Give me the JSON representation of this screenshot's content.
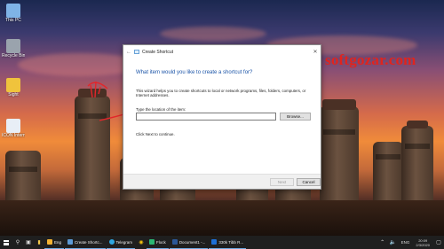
{
  "watermark": "softgozar.com",
  "desktop_icons": [
    {
      "label": "This PC",
      "color": "#7fb3e6"
    },
    {
      "label": "Recycle Bin",
      "color": "#9aa3ad"
    },
    {
      "label": "Sight",
      "color": "#f0c33c"
    },
    {
      "label": "ICON Internet",
      "color": "#e8eef6"
    }
  ],
  "dialog": {
    "title": "Create Shortcut",
    "heading": "What item would you like to create a shortcut for?",
    "description": "This wizard helps you to create shortcuts to local or network programs, files, folders, computers, or Internet addresses.",
    "location_label": "Type the location of the item:",
    "location_value": "",
    "browse_label": "Browse...",
    "hint": "Click Next to continue.",
    "next_label": "Next",
    "cancel_label": "Cancel"
  },
  "taskbar": {
    "apps": [
      {
        "label": "Eng",
        "color": "#f2b233"
      },
      {
        "label": "Create Shortc...",
        "color": "#5d9ad6"
      },
      {
        "label": "Telegram",
        "color": "#2ea6e0"
      },
      {
        "label": "Flock",
        "color": "#2bb673"
      },
      {
        "label": "Document1 -...",
        "color": "#2b5797"
      },
      {
        "label": "330k Tibb R...",
        "color": "#1e6fd6"
      }
    ],
    "tray_text": "ENG",
    "time": "20:09",
    "date": "2/3/2020"
  },
  "colors": {
    "heading": "#1c55a8",
    "watermark": "#e0241e",
    "annotation": "#e3262b",
    "taskbar": "#1f1f1f"
  }
}
